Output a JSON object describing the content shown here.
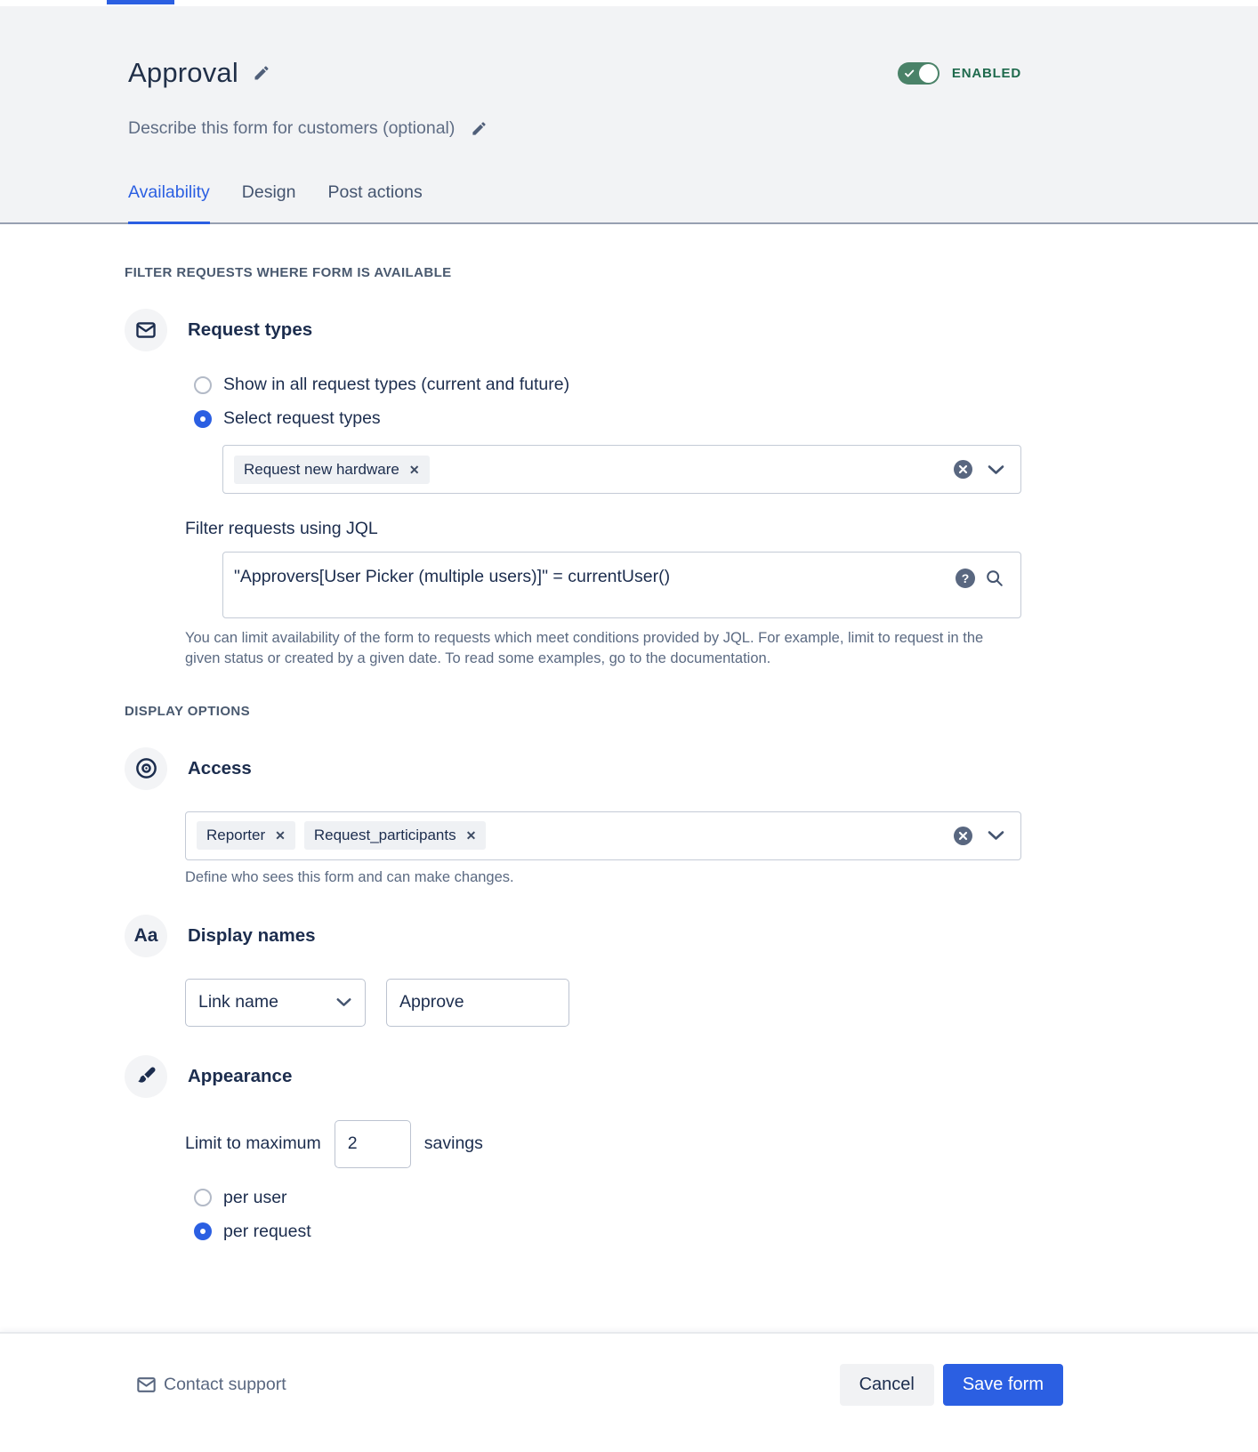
{
  "header": {
    "title": "Approval",
    "description_placeholder": "Describe this form for customers (optional)",
    "status": {
      "label": "ENABLED",
      "on": true
    },
    "tabs": [
      {
        "label": "Availability",
        "active": true
      },
      {
        "label": "Design",
        "active": false
      },
      {
        "label": "Post actions",
        "active": false
      }
    ]
  },
  "availability": {
    "filter_section_label": "FILTER REQUESTS WHERE FORM IS AVAILABLE",
    "request_types": {
      "heading": "Request types",
      "options": [
        {
          "label": "Show in all request types (current and future)",
          "selected": false
        },
        {
          "label": "Select request types",
          "selected": true
        }
      ],
      "selected_types": [
        "Request new hardware"
      ]
    },
    "jql": {
      "label": "Filter requests using JQL",
      "value": "\"Approvers[User Picker (multiple users)]\" = currentUser()",
      "help": "You can limit availability of the form to requests which meet conditions provided by JQL. For example, limit to request in the given status or created by a given date. To read some examples, go to the documentation."
    },
    "display_section_label": "DISPLAY OPTIONS",
    "access": {
      "heading": "Access",
      "selected_values": [
        "Reporter",
        "Request_participants"
      ],
      "help": "Define who sees this form and can make changes."
    },
    "display_names": {
      "heading": "Display names",
      "name_type_selected": "Link name",
      "name_value": "Approve"
    },
    "appearance": {
      "heading": "Appearance",
      "limit_label": "Limit to maximum",
      "limit_value": "2",
      "limit_suffix": "savings",
      "options": [
        {
          "label": "per user",
          "selected": false
        },
        {
          "label": "per request",
          "selected": true
        }
      ]
    }
  },
  "footer": {
    "contact_support_label": "Contact support",
    "cancel_label": "Cancel",
    "save_label": "Save form"
  },
  "colors": {
    "accent_blue": "#2b5fe2",
    "toggle_green": "#4a8268",
    "enabled_text_green": "#1f6a4d",
    "text_dark": "#1c2d4e",
    "text_muted": "#5e6c84",
    "header_background": "#f2f3f5"
  }
}
